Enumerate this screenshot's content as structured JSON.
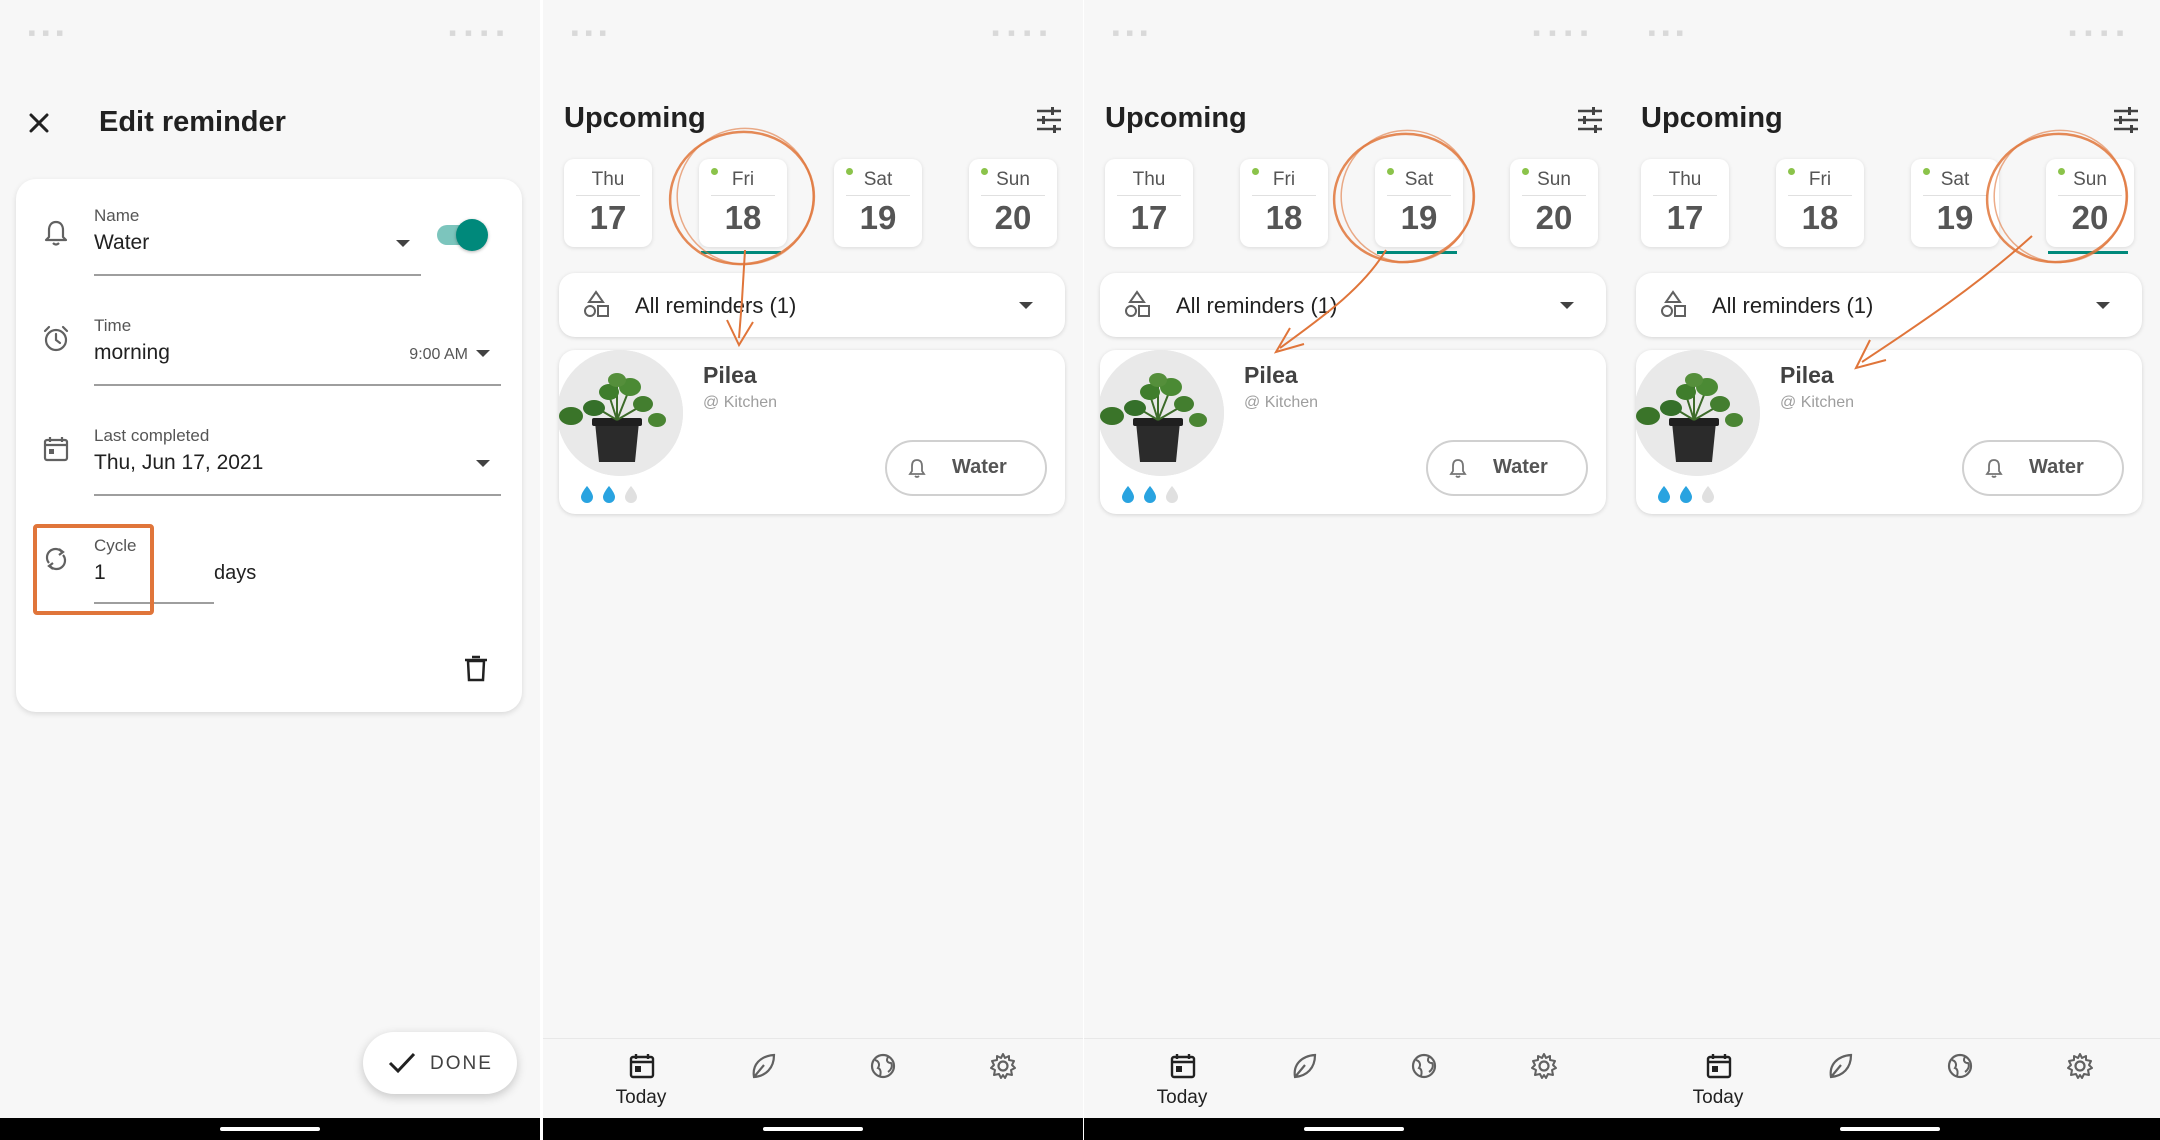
{
  "edit": {
    "title": "Edit reminder",
    "name_label": "Name",
    "name_value": "Water",
    "time_label": "Time",
    "time_value": "morning",
    "time_clock": "9:00 AM",
    "last_label": "Last completed",
    "last_value": "Thu, Jun 17, 2021",
    "cycle_label": "Cycle",
    "cycle_value": "1",
    "cycle_unit": "days",
    "done_label": "DONE",
    "enabled": true
  },
  "upcoming": {
    "title": "Upcoming",
    "days": [
      {
        "name": "Thu",
        "date": "17"
      },
      {
        "name": "Fri",
        "date": "18"
      },
      {
        "name": "Sat",
        "date": "19"
      },
      {
        "name": "Sun",
        "date": "20"
      }
    ],
    "filter_label": "All reminders (1)",
    "plant_name": "Pilea",
    "plant_location": "@ Kitchen",
    "action_label": "Water",
    "water_level": {
      "filled": 2,
      "total": 3
    },
    "nav_today": "Today"
  },
  "colors": {
    "accent": "#00897b",
    "annotation": "#e0753a",
    "dot": "#8bc34a",
    "drop": "#29a3e0"
  },
  "screens": [
    {
      "selected_day": "Fri"
    },
    {
      "selected_day": "Sat"
    },
    {
      "selected_day": "Sun"
    }
  ]
}
